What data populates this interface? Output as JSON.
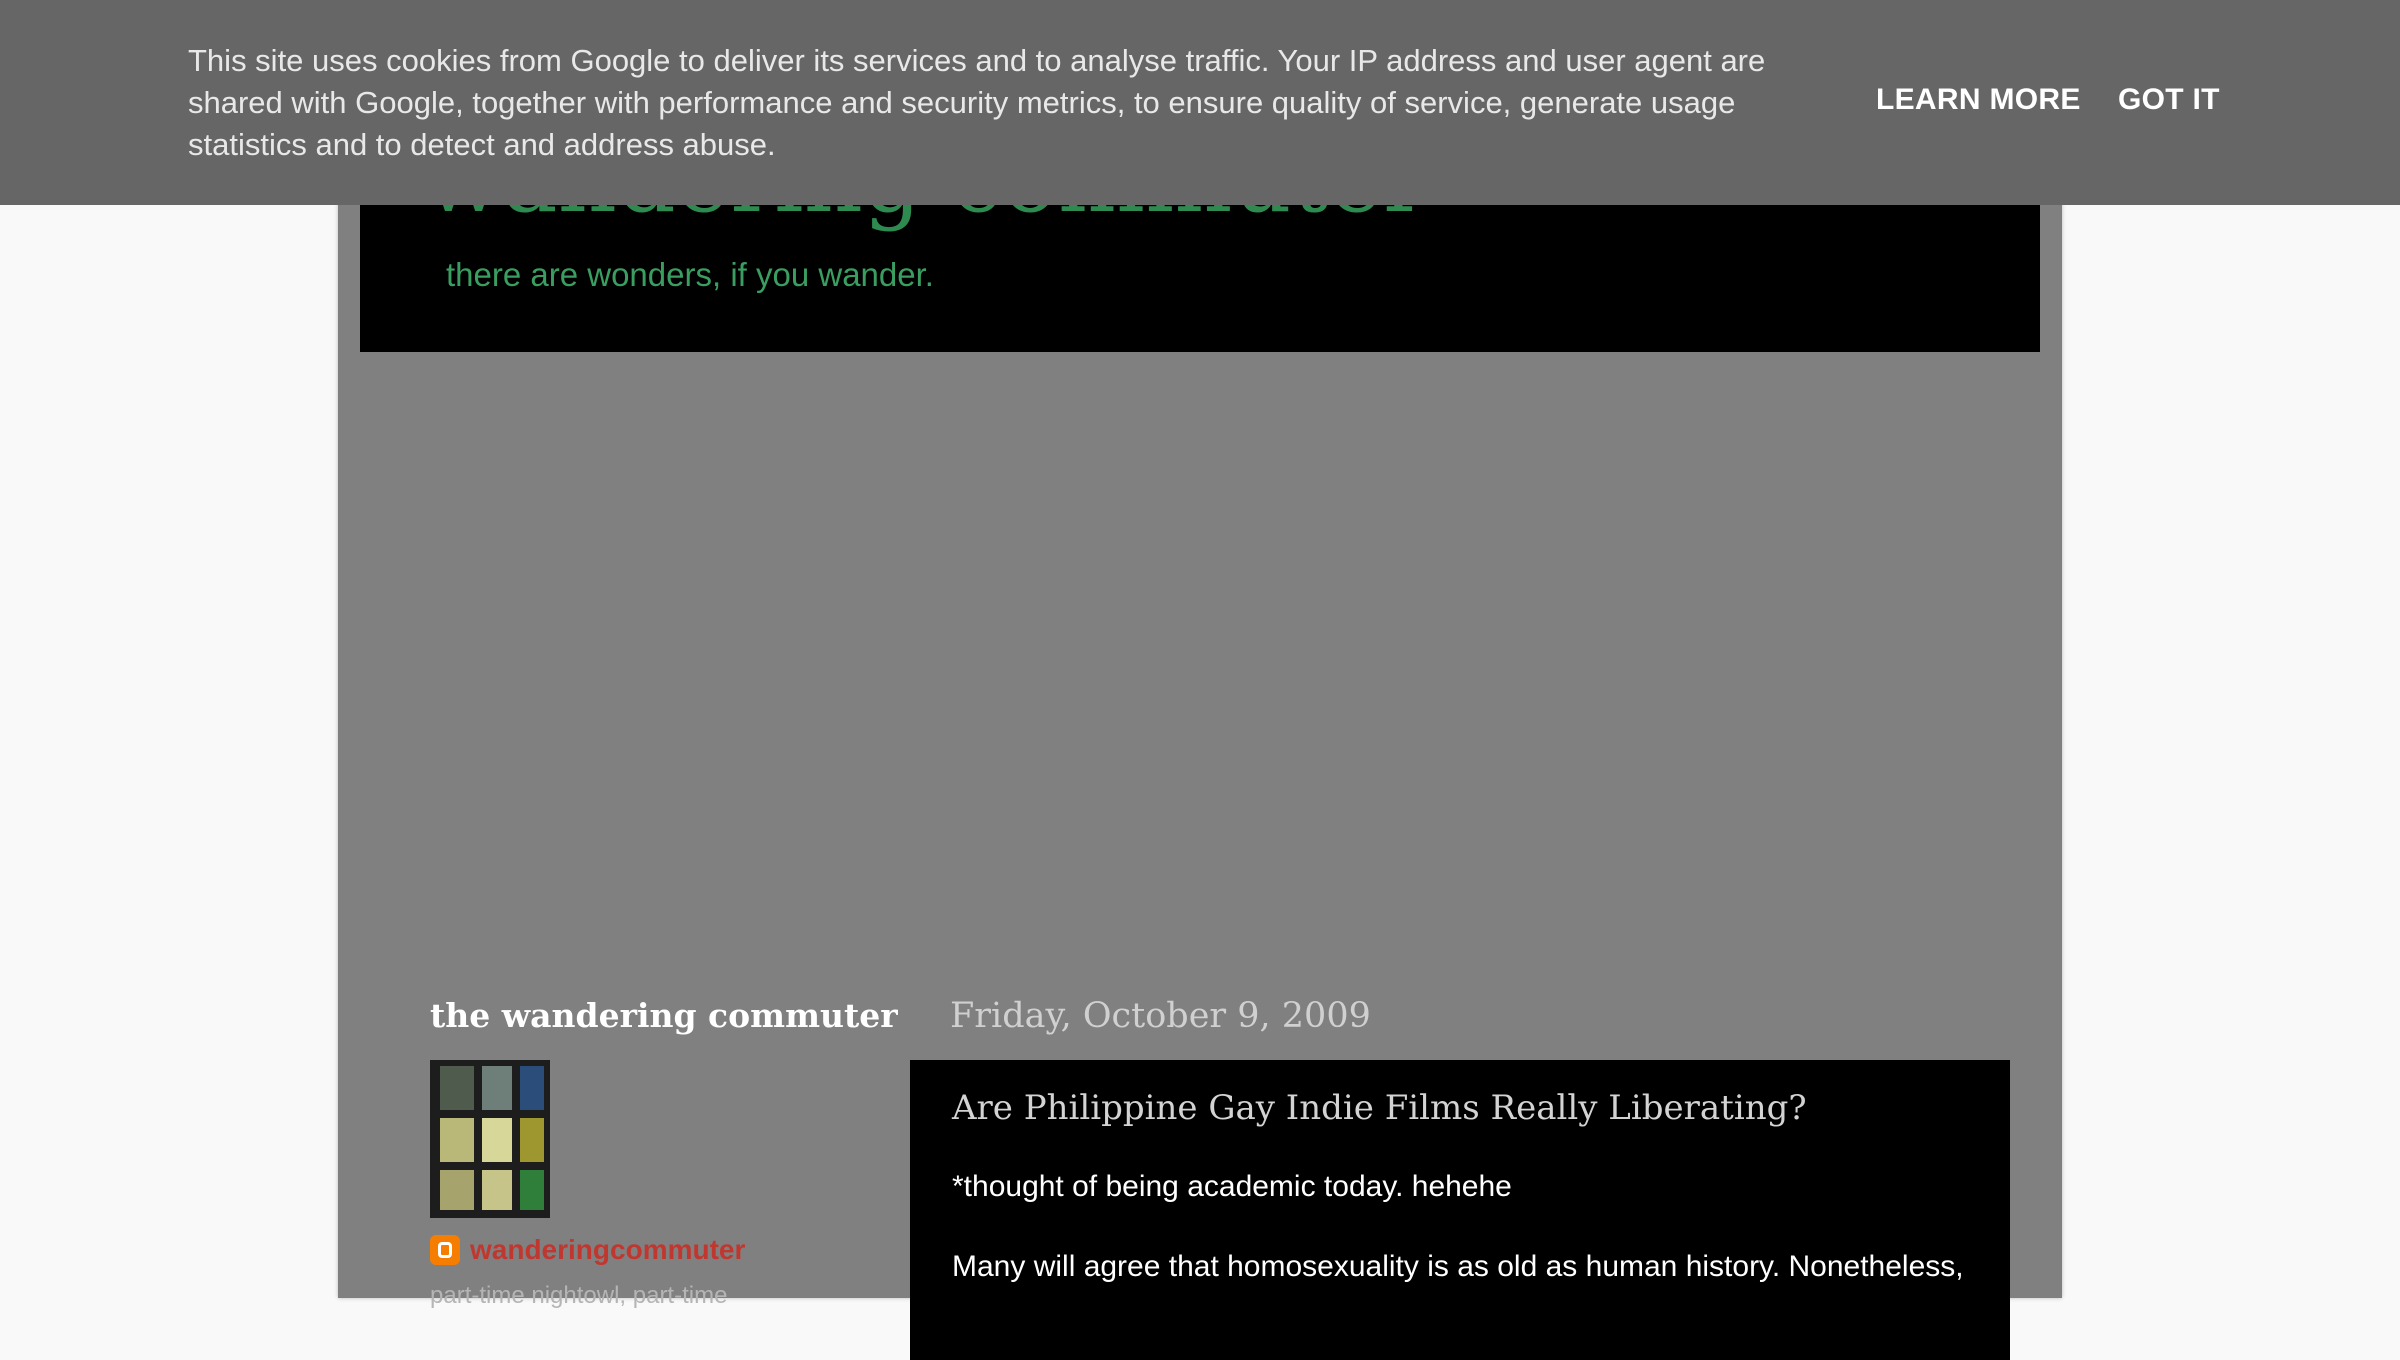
{
  "blog": {
    "title": "wandering commuter",
    "description": "there are wonders, if you wander."
  },
  "sidebar": {
    "title": "the wandering commuter",
    "profile_name": "wanderingcommuter",
    "profile_about": "part-time nightowl, part-time"
  },
  "post": {
    "date": "Friday, October 9, 2009",
    "title": "Are Philippine Gay Indie Films Really Liberating?",
    "intro": "*thought of being academic today. hehehe",
    "body": "Many will agree that homosexuality is as old as human history. Nonetheless,"
  },
  "cookie": {
    "message": "This site uses cookies from Google to deliver its services and to analyse traffic. Your IP address and user agent are shared with Google, together with performance and security metrics, to ensure quality of service, generate usage statistics and to detect and address abuse.",
    "learn_more": "LEARN MORE",
    "got_it": "GOT IT"
  },
  "icons": {
    "blogger": "blogger-icon"
  },
  "colors": {
    "title_green": "#2e8a4f",
    "cookie_bar": "#666666",
    "profile_link": "#c0372f",
    "blogger_orange": "#f57d00"
  }
}
